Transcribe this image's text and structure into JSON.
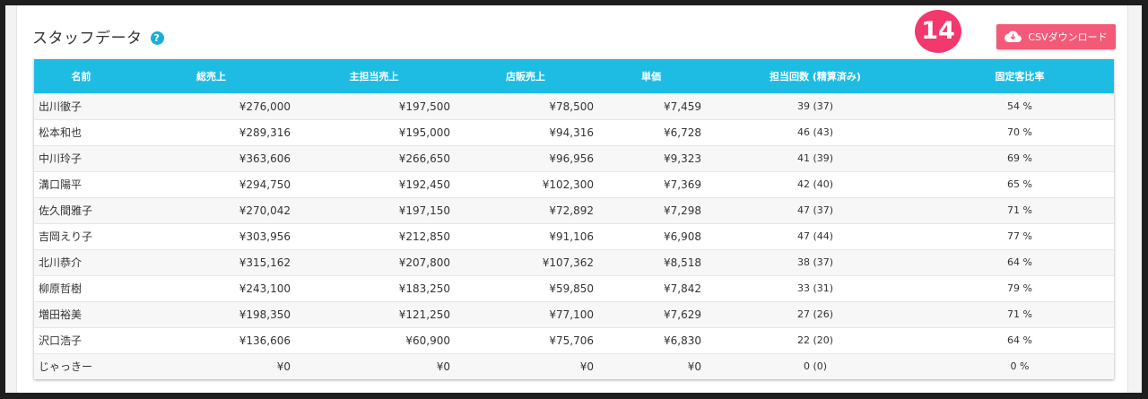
{
  "header": {
    "title": "スタッフデータ",
    "badge": "14",
    "csv_label": "CSVダウンロード"
  },
  "table": {
    "columns": [
      "名前",
      "総売上",
      "主担当売上",
      "店販売上",
      "単価",
      "担当回数 (精算済み)",
      "固定客比率"
    ],
    "rows": [
      {
        "name": "出川徹子",
        "total": "¥276,000",
        "main": "¥197,500",
        "retail": "¥78,500",
        "unit": "¥7,459",
        "count": "39 (37)",
        "rate": "54 %"
      },
      {
        "name": "松本和也",
        "total": "¥289,316",
        "main": "¥195,000",
        "retail": "¥94,316",
        "unit": "¥6,728",
        "count": "46 (43)",
        "rate": "70 %"
      },
      {
        "name": "中川玲子",
        "total": "¥363,606",
        "main": "¥266,650",
        "retail": "¥96,956",
        "unit": "¥9,323",
        "count": "41 (39)",
        "rate": "69 %"
      },
      {
        "name": "溝口陽平",
        "total": "¥294,750",
        "main": "¥192,450",
        "retail": "¥102,300",
        "unit": "¥7,369",
        "count": "42 (40)",
        "rate": "65 %"
      },
      {
        "name": "佐久間雅子",
        "total": "¥270,042",
        "main": "¥197,150",
        "retail": "¥72,892",
        "unit": "¥7,298",
        "count": "47 (37)",
        "rate": "71 %"
      },
      {
        "name": "吉岡えり子",
        "total": "¥303,956",
        "main": "¥212,850",
        "retail": "¥91,106",
        "unit": "¥6,908",
        "count": "47 (44)",
        "rate": "77 %"
      },
      {
        "name": "北川恭介",
        "total": "¥315,162",
        "main": "¥207,800",
        "retail": "¥107,362",
        "unit": "¥8,518",
        "count": "38 (37)",
        "rate": "64 %"
      },
      {
        "name": "柳原哲樹",
        "total": "¥243,100",
        "main": "¥183,250",
        "retail": "¥59,850",
        "unit": "¥7,842",
        "count": "33 (31)",
        "rate": "79 %"
      },
      {
        "name": "増田裕美",
        "total": "¥198,350",
        "main": "¥121,250",
        "retail": "¥77,100",
        "unit": "¥7,629",
        "count": "27 (26)",
        "rate": "71 %"
      },
      {
        "name": "沢口浩子",
        "total": "¥136,606",
        "main": "¥60,900",
        "retail": "¥75,706",
        "unit": "¥6,830",
        "count": "22 (20)",
        "rate": "64 %"
      },
      {
        "name": "じゃっきー",
        "total": "¥0",
        "main": "¥0",
        "retail": "¥0",
        "unit": "¥0",
        "count": "0 (0)",
        "rate": "0 %"
      }
    ]
  },
  "colors": {
    "accent": "#1ebce3",
    "button": "#f25a78",
    "badge": "#f2386d"
  }
}
